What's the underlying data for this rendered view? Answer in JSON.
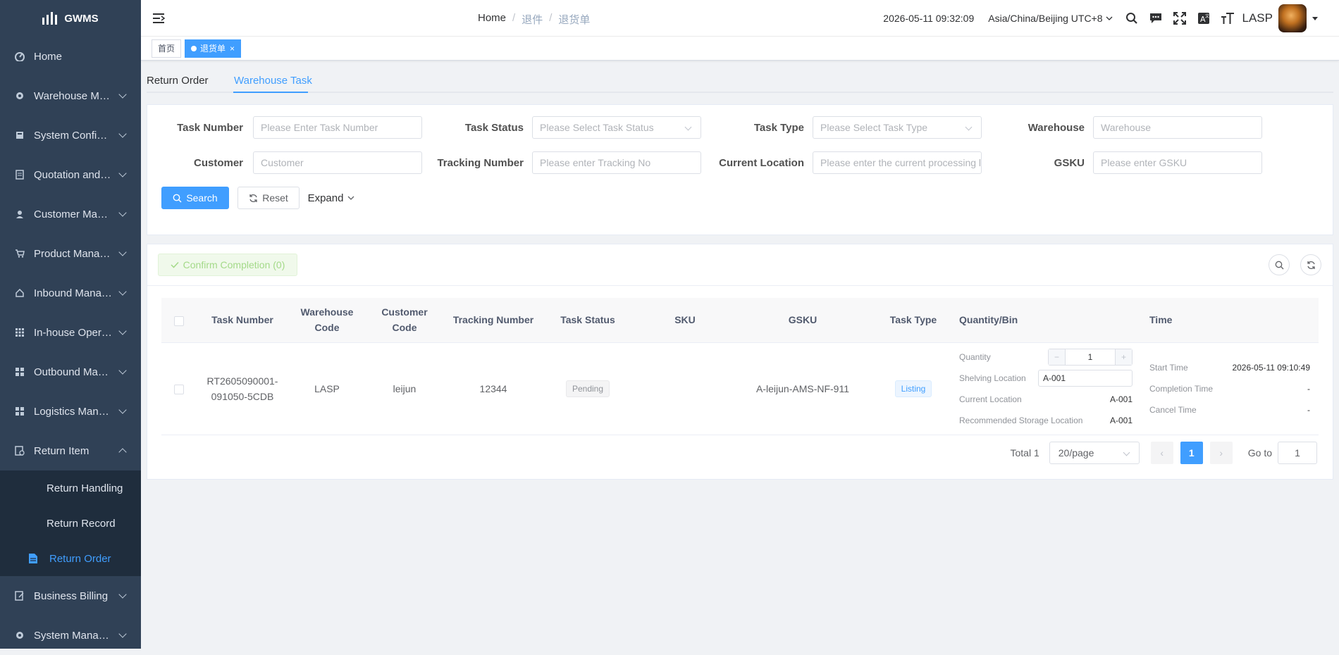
{
  "app": {
    "name": "GWMS"
  },
  "sidebar": {
    "items": [
      {
        "label": "Home",
        "icon": "dashboard-icon"
      },
      {
        "label": "Warehouse Management",
        "icon": "warehouse-icon"
      },
      {
        "label": "System Configuration",
        "icon": "config-icon"
      },
      {
        "label": "Quotation and Pricing",
        "icon": "quotation-icon"
      },
      {
        "label": "Customer Management",
        "icon": "user-icon"
      },
      {
        "label": "Product Management",
        "icon": "cart-icon"
      },
      {
        "label": "Inbound Management",
        "icon": "inbound-icon"
      },
      {
        "label": "In-house Operations",
        "icon": "grid-icon"
      },
      {
        "label": "Outbound Management",
        "icon": "outbound-icon"
      },
      {
        "label": "Logistics Management",
        "icon": "logistics-icon"
      },
      {
        "label": "Return Item",
        "icon": "return-icon"
      }
    ],
    "return_sub": [
      {
        "label": "Return Handling"
      },
      {
        "label": "Return Record"
      },
      {
        "label": "Return Order"
      }
    ],
    "after": [
      {
        "label": "Business Billing",
        "icon": "billing-icon"
      },
      {
        "label": "System Management",
        "icon": "settings-icon"
      }
    ]
  },
  "header": {
    "breadcrumb": [
      "Home",
      "退件",
      "退货单"
    ],
    "datetime": "2026-05-11 09:32:09",
    "timezone": "Asia/China/Beijing UTC+8",
    "user": "LASP"
  },
  "tags": {
    "home": "首页",
    "current": "退货单"
  },
  "tabs": {
    "return_order": "Return Order",
    "warehouse_task": "Warehouse Task"
  },
  "form": {
    "task_number": {
      "label": "Task Number",
      "placeholder": "Please Enter Task Number"
    },
    "task_status": {
      "label": "Task Status",
      "placeholder": "Please Select Task Status"
    },
    "task_type": {
      "label": "Task Type",
      "placeholder": "Please Select Task Type"
    },
    "warehouse": {
      "label": "Warehouse",
      "placeholder": "Warehouse"
    },
    "customer": {
      "label": "Customer",
      "placeholder": "Customer"
    },
    "tracking": {
      "label": "Tracking Number",
      "placeholder": "Please enter Tracking No"
    },
    "location": {
      "label": "Current Location",
      "placeholder": "Please enter the current processing location"
    },
    "gsku": {
      "label": "GSKU",
      "placeholder": "Please enter GSKU"
    },
    "search": "Search",
    "reset": "Reset",
    "expand": "Expand"
  },
  "toolbar": {
    "confirm": "Confirm Completion (0)"
  },
  "table": {
    "headers": {
      "task_number": "Task Number",
      "warehouse_code_1": "Warehouse",
      "warehouse_code_2": "Code",
      "customer_code_1": "Customer",
      "customer_code_2": "Code",
      "tracking": "Tracking Number",
      "status": "Task Status",
      "sku": "SKU",
      "gsku": "GSKU",
      "type": "Task Type",
      "qty_bin": "Quantity/Bin",
      "time": "Time"
    },
    "rows": [
      {
        "task_number_1": "RT2605090001-",
        "task_number_2": "091050-5CDB",
        "warehouse_code": "LASP",
        "customer_code": "leijun",
        "tracking": "12344",
        "status": "Pending",
        "sku": "",
        "gsku": "A-leijun-AMS-NF-911",
        "type": "Listing",
        "qty_label": "Quantity",
        "qty_value": "1",
        "shelving_label": "Shelving Location",
        "shelving_value": "A-001",
        "current_label": "Current Location",
        "current_value": "A-001",
        "recommended_label": "Recommended Storage Location",
        "recommended_value": "A-001",
        "start_label": "Start Time",
        "start_value": "2026-05-11 09:10:49",
        "completion_label": "Completion Time",
        "completion_value": "-",
        "cancel_label": "Cancel Time",
        "cancel_value": "-"
      }
    ]
  },
  "pagination": {
    "total": "Total 1",
    "page_size": "20/page",
    "current": "1",
    "goto_label": "Go to",
    "goto_value": "1"
  },
  "colors": {
    "accent": "#409eff",
    "sidebar_bg": "#304156",
    "submenu_bg": "#1f2d3d"
  }
}
